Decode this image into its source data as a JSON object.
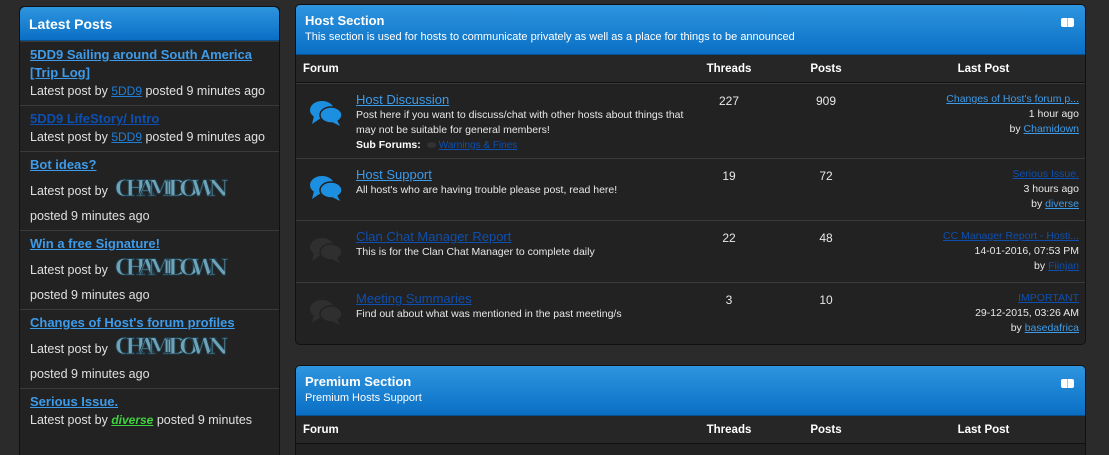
{
  "sidebar": {
    "title": "Latest Posts",
    "latest_post_by": "Latest post by",
    "items": [
      {
        "title": "5DD9 Sailing around South America [Trip Log]",
        "user": "5DD9",
        "posted": "posted 9 minutes ago"
      },
      {
        "title": "5DD9 LifeStory/ Intro",
        "user": "5DD9",
        "posted": "posted 9 minutes ago"
      },
      {
        "title": "Bot ideas?",
        "user": "CHAMIDOWN",
        "posted": "posted 9 minutes ago"
      },
      {
        "title": "Win a free Signature!",
        "user": "CHAMIDOWN",
        "posted": "posted 9 minutes ago"
      },
      {
        "title": "Changes of Host's forum profiles",
        "user": "CHAMIDOWN",
        "posted": "posted 9 minutes ago"
      },
      {
        "title": "Serious Issue.",
        "user": "diverse",
        "posted": "posted 9 minutes"
      }
    ]
  },
  "host_section": {
    "title": "Host Section",
    "description": "This section is used for hosts to communicate privately as well as a place for things to be announced",
    "columns": {
      "forum": "Forum",
      "threads": "Threads",
      "posts": "Posts",
      "last_post": "Last Post"
    },
    "rows": [
      {
        "name": "Host Discussion",
        "description": "Post here if you want to discuss/chat with other hosts about things that may not be suitable for general members!",
        "subforums_label": "Sub Forums:",
        "subforum": "Warnings & Fines",
        "threads": "227",
        "posts": "909",
        "last_title": "Changes of Host's forum p...",
        "last_date": "1 hour ago",
        "last_by": "by",
        "last_user": "Chamidown"
      },
      {
        "name": "Host Support",
        "description": "All host's who are having trouble please post, read here!",
        "threads": "19",
        "posts": "72",
        "last_title": "Serious Issue.",
        "last_date": "3 hours ago",
        "last_by": "by",
        "last_user": "diverse"
      },
      {
        "name": "Clan Chat Manager Report",
        "description": "This is for the Clan Chat Manager to complete daily",
        "threads": "22",
        "posts": "48",
        "last_title": "CC Manager Report - Hosti...",
        "last_date": "14-01-2016, 07:53 PM",
        "last_by": "by",
        "last_user": "Fiinjan"
      },
      {
        "name": "Meeting Summaries",
        "description": "Find out about what was mentioned in the past meeting/s",
        "threads": "3",
        "posts": "10",
        "last_title": "IMPORTANT",
        "last_date": "29-12-2015, 03:26 AM",
        "last_by": "by",
        "last_user": "basedafrica"
      }
    ]
  },
  "premium_section": {
    "title": "Premium Section",
    "description": "Premium Hosts Support",
    "columns": {
      "forum": "Forum",
      "threads": "Threads",
      "posts": "Posts",
      "last_post": "Last Post"
    }
  },
  "colors": {
    "header_blue": "#0a6fc4",
    "link_blue": "#3d9be9",
    "dark_link": "#0e4fb0",
    "bg": "#2b2b2b",
    "panel": "#222222"
  }
}
